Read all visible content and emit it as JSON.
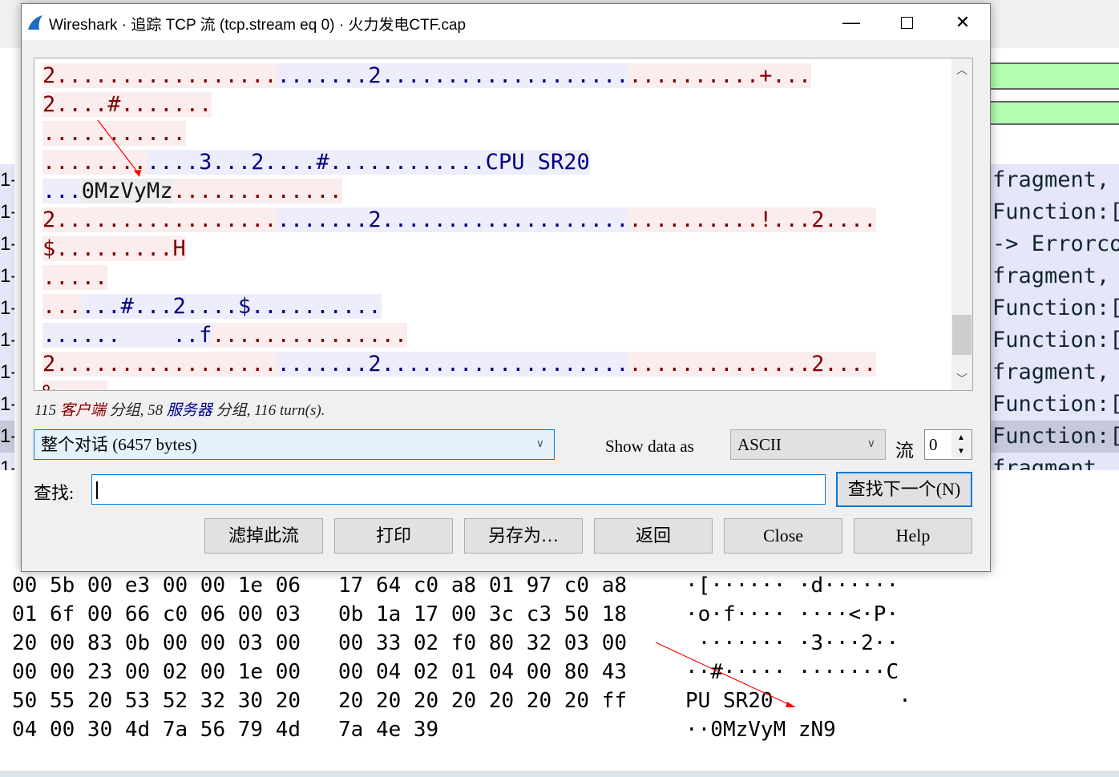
{
  "dialog": {
    "title": "Wireshark · 追踪 TCP 流 (tcp.stream eq 0) · 火力发电CTF.cap",
    "stream_lines": [
      [
        [
          "c",
          "2................."
        ],
        [
          "s",
          ".......2..................."
        ],
        [
          "c",
          "..........+..."
        ]
      ],
      [
        [
          "c",
          "2....#......."
        ]
      ],
      [
        [
          "c",
          "..........."
        ]
      ],
      [
        [
          "c",
          "........"
        ],
        [
          "s",
          "....3...2....#............CPU SR20"
        ]
      ],
      [
        [
          "s",
          "..."
        ],
        [
          "h",
          "0MzVyMz"
        ],
        [
          "c",
          "............."
        ]
      ],
      [
        [
          "c",
          "2................."
        ],
        [
          "s",
          ".......2..................."
        ],
        [
          "c",
          "..........!...2...."
        ]
      ],
      [
        [
          "c",
          "$.........H"
        ]
      ],
      [
        [
          "c",
          "....."
        ]
      ],
      [
        [
          "c",
          "..."
        ],
        [
          "s",
          "...#...2....$.........."
        ]
      ],
      [
        [
          "s",
          "......    ..f"
        ],
        [
          "c",
          "..............."
        ]
      ],
      [
        [
          "c",
          "2................."
        ],
        [
          "s",
          ".......2..................."
        ],
        [
          "c",
          "..............2...."
        ]
      ],
      [
        [
          "c",
          "%    "
        ]
      ]
    ],
    "summary": {
      "client_count": "115",
      "client_label": "客户端",
      "packets": "分组,",
      "server_count": "58",
      "server_label": "服务器",
      "packets2": "分组,",
      "turns": "116 turn(s)."
    },
    "conversation_select": "整个对话 (6457 bytes)",
    "show_data_as_label": "Show data as",
    "show_data_as_value": "ASCII",
    "stream_label": "流",
    "stream_number": "0",
    "find_label": "查找:",
    "find_value": "",
    "find_next_button": "查找下一个(N)",
    "buttons": {
      "filter_out": "滤掉此流",
      "print": "打印",
      "save_as": "另存为…",
      "back": "返回",
      "close": "Close",
      "help": "Help"
    },
    "colors": {
      "client": "#7f0000",
      "server": "#00007f",
      "client_bg": "#fbeded",
      "server_bg": "#ededfb"
    }
  },
  "packet_list_info": [
    "fragment,",
    "Function:[",
    "-> Errorco",
    "fragment,",
    "Function:[",
    "Function:[",
    "fragment,",
    "Function:[",
    "Function:[",
    "fragment"
  ],
  "hex_dump": {
    "hex_rows": [
      "00 5b 00 e3 00 00 1e 06   17 64 c0 a8 01 97 c0 a8",
      "01 6f 00 66 c0 06 00 03   0b 1a 17 00 3c c3 50 18",
      "20 00 83 0b 00 00 03 00   00 33 02 f0 80 32 03 00",
      "00 00 23 00 02 00 1e 00   00 04 02 01 04 00 80 43",
      "50 55 20 53 52 32 30 20   20 20 20 20 20 20 20 ff",
      "04 00 30 4d 7a 56 79 4d   7a 4e 39"
    ],
    "ascii_rows": [
      "·[······ ·d······",
      "·o·f···· ····<·P·",
      " ······· ·3···2··",
      "··#····· ·······C",
      "PU SR20          ·",
      "··0MzVyM zN9"
    ]
  }
}
